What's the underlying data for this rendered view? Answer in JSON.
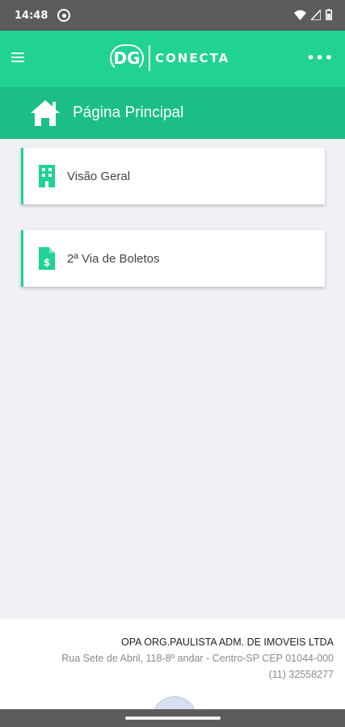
{
  "status_bar": {
    "time": "14:48"
  },
  "app_bar": {
    "logo_mark": "DG",
    "logo_text": "CONECTA",
    "more_label": "•••"
  },
  "page_header": {
    "title": "Página Principal",
    "icon": "home-icon"
  },
  "cards": [
    {
      "label": "Visão Geral",
      "icon": "building-icon"
    },
    {
      "label": "2ª Via de Boletos",
      "icon": "invoice-dollar-icon"
    }
  ],
  "footer": {
    "company": "OPA ORG.PAULISTA ADM. DE IMOVEIS LTDA",
    "address": "Rua Sete de Abril, 118-8º andar - Centro-SP CEP 01044-000",
    "phone": "(11) 32558277"
  },
  "colors": {
    "primary": "#20d393",
    "header": "#1bbf85",
    "background": "#eff1f4"
  }
}
